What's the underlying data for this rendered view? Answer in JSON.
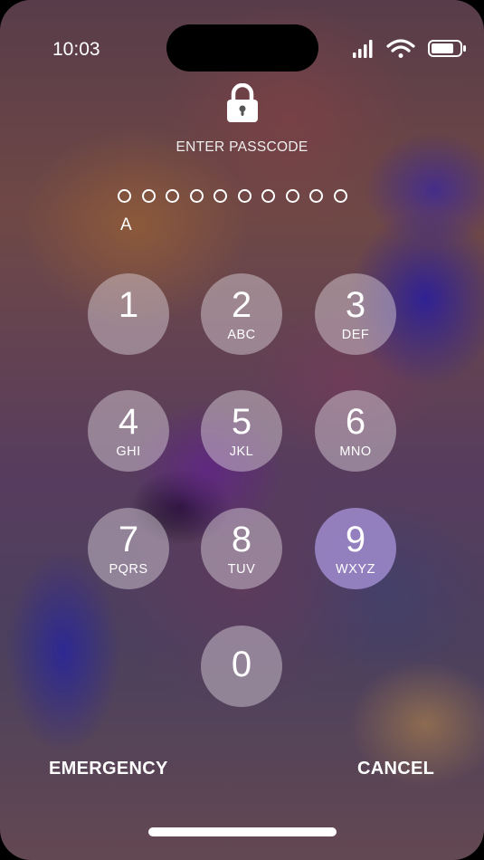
{
  "status_bar": {
    "time": "10:03",
    "signal_icon": "cellular-signal-icon",
    "wifi_icon": "wifi-icon",
    "battery_icon": "battery-icon"
  },
  "lock_icon": "lock-icon",
  "prompt": "ENTER PASSCODE",
  "passcode": {
    "dot_count": 10,
    "typed_text": "A"
  },
  "keypad": [
    {
      "digit": "1",
      "letters": ""
    },
    {
      "digit": "2",
      "letters": "ABC"
    },
    {
      "digit": "3",
      "letters": "DEF"
    },
    {
      "digit": "4",
      "letters": "GHI"
    },
    {
      "digit": "5",
      "letters": "JKL"
    },
    {
      "digit": "6",
      "letters": "MNO"
    },
    {
      "digit": "7",
      "letters": "PQRS"
    },
    {
      "digit": "8",
      "letters": "TUV"
    },
    {
      "digit": "9",
      "letters": "WXYZ"
    },
    {
      "digit": "0",
      "letters": ""
    }
  ],
  "actions": {
    "emergency": "EMERGENCY",
    "cancel": "CANCEL"
  },
  "colors": {
    "pressed_key": "#A096DC",
    "key": "#E1D7E1"
  }
}
